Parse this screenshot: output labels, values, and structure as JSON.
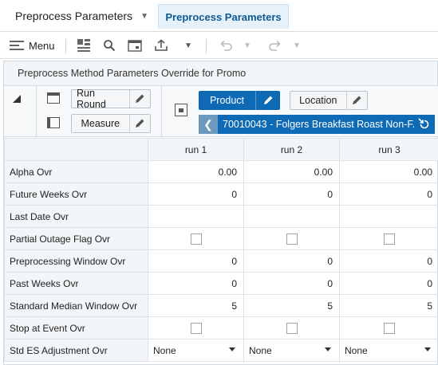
{
  "tabs": [
    {
      "label": "Preprocess Parameters",
      "active": false
    },
    {
      "label": "Preprocess Parameters",
      "active": true
    }
  ],
  "toolbar": {
    "menu_label": "Menu"
  },
  "panel": {
    "title": "Preprocess Method Parameters Override for Promo",
    "layout": {
      "rows": [
        "Run Round",
        "Measure"
      ],
      "columns": [
        "Product",
        "Location"
      ],
      "product_nav": "70010043 - Folgers Breakfast Roast Non-F..."
    }
  },
  "grid": {
    "columns": [
      "run 1",
      "run 2",
      "run 3"
    ],
    "rows": [
      {
        "label": "Alpha Ovr",
        "type": "num",
        "values": [
          "0.00",
          "0.00",
          "0.00"
        ]
      },
      {
        "label": "Future Weeks Ovr",
        "type": "num",
        "values": [
          "0",
          "0",
          "0"
        ]
      },
      {
        "label": "Last Date Ovr",
        "type": "num",
        "values": [
          "",
          "",
          ""
        ]
      },
      {
        "label": "Partial Outage Flag Ovr",
        "type": "cb",
        "values": [
          "",
          "",
          ""
        ]
      },
      {
        "label": "Preprocessing Window Ovr",
        "type": "num",
        "values": [
          "0",
          "0",
          "0"
        ]
      },
      {
        "label": "Past Weeks Ovr",
        "type": "num",
        "values": [
          "0",
          "0",
          "0"
        ]
      },
      {
        "label": "Standard Median Window Ovr",
        "type": "num",
        "values": [
          "5",
          "5",
          "5"
        ]
      },
      {
        "label": "Stop at Event Ovr",
        "type": "cb",
        "values": [
          "",
          "",
          ""
        ]
      },
      {
        "label": "Std ES Adjustment Ovr",
        "type": "dd",
        "values": [
          "None",
          "None",
          "None"
        ]
      }
    ]
  },
  "colors": {
    "accent": "#0f6ab6",
    "tab_active_text": "#0d5a94"
  }
}
